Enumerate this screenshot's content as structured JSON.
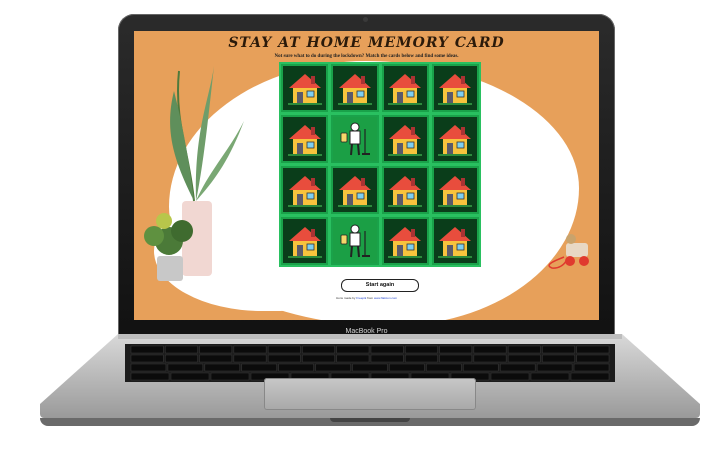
{
  "laptop": {
    "brand": "MacBook Pro"
  },
  "game": {
    "title": "STAY AT HOME MEMORY CARD",
    "subtitle": "Not sure what to do during the lockdown? Match the cards below and find some ideas.",
    "restart_label": "Start again",
    "credits_prefix": "Icons made by",
    "credits_author": "Freepik",
    "credits_middle": "from",
    "credits_site": "www.flaticon.com",
    "cards": [
      {
        "face": "house"
      },
      {
        "face": "house"
      },
      {
        "face": "house"
      },
      {
        "face": "house"
      },
      {
        "face": "house"
      },
      {
        "face": "cleaner"
      },
      {
        "face": "house"
      },
      {
        "face": "house"
      },
      {
        "face": "house"
      },
      {
        "face": "house"
      },
      {
        "face": "house"
      },
      {
        "face": "house"
      },
      {
        "face": "house"
      },
      {
        "face": "cleaner"
      },
      {
        "face": "house"
      },
      {
        "face": "house"
      }
    ]
  },
  "colors": {
    "background": "#e7a05a",
    "board": "#29c060",
    "card_back": "#0a3d1a",
    "card_flipped": "#1b9f45"
  }
}
